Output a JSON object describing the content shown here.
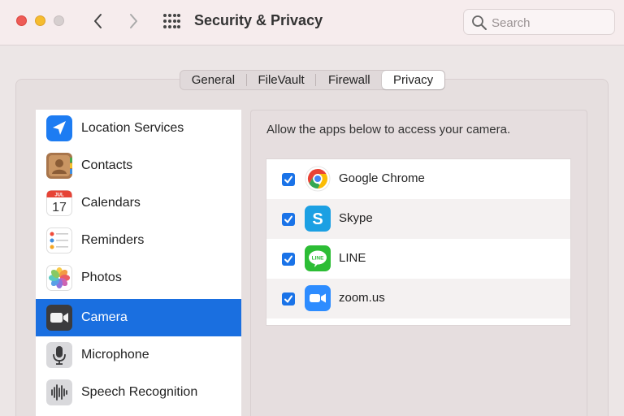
{
  "window": {
    "title": "Security & Privacy"
  },
  "search": {
    "placeholder": "Search",
    "value": ""
  },
  "tabs": [
    {
      "label": "General",
      "selected": false
    },
    {
      "label": "FileVault",
      "selected": false
    },
    {
      "label": "Firewall",
      "selected": false
    },
    {
      "label": "Privacy",
      "selected": true
    }
  ],
  "sidebar": {
    "items": [
      {
        "label": "Location Services",
        "icon": "location-arrow-icon",
        "selected": false
      },
      {
        "label": "Contacts",
        "icon": "contacts-book-icon",
        "selected": false
      },
      {
        "label": "Calendars",
        "icon": "calendar-icon",
        "month": "JUL",
        "day": "17",
        "selected": false
      },
      {
        "label": "Reminders",
        "icon": "reminders-list-icon",
        "selected": false
      },
      {
        "label": "Photos",
        "icon": "photos-flower-icon",
        "selected": false
      },
      {
        "label": "Camera",
        "icon": "camera-icon",
        "selected": true
      },
      {
        "label": "Microphone",
        "icon": "microphone-icon",
        "selected": false
      },
      {
        "label": "Speech Recognition",
        "icon": "speech-waveform-icon",
        "selected": false
      }
    ]
  },
  "camera_pane": {
    "heading": "Allow the apps below to access your camera.",
    "apps": [
      {
        "label": "Google Chrome",
        "icon": "chrome-icon",
        "checked": true
      },
      {
        "label": "Skype",
        "icon": "skype-icon",
        "checked": true
      },
      {
        "label": "LINE",
        "icon": "line-icon",
        "icon_text": "LINE",
        "checked": true
      },
      {
        "label": "zoom.us",
        "icon": "zoom-icon",
        "checked": true
      }
    ]
  },
  "colors": {
    "selection_blue": "#1a6fe0",
    "checkbox_blue": "#1a73e8",
    "close": "#ee5b56",
    "minimize": "#f5bc2f"
  }
}
